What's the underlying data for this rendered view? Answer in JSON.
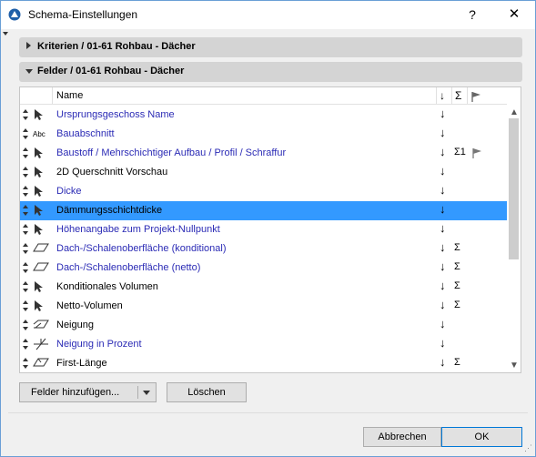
{
  "window": {
    "title": "Schema-Einstellungen",
    "help_label": "?",
    "close_label": "✕"
  },
  "sections": {
    "criteria": {
      "label": "Kriterien / 01-61 Rohbau - Dächer",
      "expanded": false
    },
    "fields": {
      "label": "Felder / 01-61 Rohbau - Dächer",
      "expanded": true
    }
  },
  "list": {
    "header": {
      "name": "Name",
      "sort_icon": "↓",
      "sum_icon": "Σ",
      "flag_icon": "flag-icon"
    },
    "rows": [
      {
        "label": "Ursprungsgeschoss Name",
        "type_icon": "pointer-icon",
        "color": "blue",
        "sort": "↓",
        "sum": "",
        "flag": false,
        "selected": false
      },
      {
        "label": "Bauabschnitt",
        "type_icon": "abc-icon",
        "type_text": "Abc",
        "color": "blue",
        "sort": "↓",
        "sum": "",
        "flag": false,
        "selected": false
      },
      {
        "label": "Baustoff / Mehrschichtiger Aufbau / Profil / Schraffur",
        "type_icon": "pointer-icon",
        "color": "blue",
        "sort": "↓",
        "sum": "Σ1",
        "flag": true,
        "selected": false
      },
      {
        "label": "2D Querschnitt Vorschau",
        "type_icon": "pointer-icon",
        "color": "black",
        "sort": "↓",
        "sum": "",
        "flag": false,
        "selected": false
      },
      {
        "label": "Dicke",
        "type_icon": "pointer-icon",
        "color": "blue",
        "sort": "↓",
        "sum": "",
        "flag": false,
        "selected": false
      },
      {
        "label": "Dämmungsschichtdicke",
        "type_icon": "pointer-icon",
        "color": "blue",
        "sort": "↓",
        "sum": "",
        "flag": false,
        "selected": true
      },
      {
        "label": "Höhenangabe zum Projekt-Nullpunkt",
        "type_icon": "pointer-icon",
        "color": "blue",
        "sort": "↓",
        "sum": "",
        "flag": false,
        "selected": false
      },
      {
        "label": "Dach-/Schalenoberfläche (konditional)",
        "type_icon": "surface-icon",
        "color": "blue",
        "sort": "↓",
        "sum": "Σ",
        "flag": false,
        "selected": false
      },
      {
        "label": "Dach-/Schalenoberfläche (netto)",
        "type_icon": "surface-icon",
        "color": "blue",
        "sort": "↓",
        "sum": "Σ",
        "flag": false,
        "selected": false
      },
      {
        "label": "Konditionales Volumen",
        "type_icon": "pointer-icon",
        "color": "black",
        "sort": "↓",
        "sum": "Σ",
        "flag": false,
        "selected": false
      },
      {
        "label": "Netto-Volumen",
        "type_icon": "pointer-icon",
        "color": "black",
        "sort": "↓",
        "sum": "Σ",
        "flag": false,
        "selected": false
      },
      {
        "label": "Neigung",
        "type_icon": "slope-icon",
        "color": "black",
        "sort": "↓",
        "sum": "",
        "flag": false,
        "selected": false
      },
      {
        "label": "Neigung in Prozent",
        "type_icon": "slope-percent-icon",
        "color": "blue",
        "sort": "↓",
        "sum": "",
        "flag": false,
        "selected": false
      },
      {
        "label": "First-Länge",
        "type_icon": "ridge-icon",
        "color": "black",
        "sort": "↓",
        "sum": "Σ",
        "flag": false,
        "selected": false
      }
    ]
  },
  "buttons": {
    "add_fields": "Felder hinzufügen...",
    "delete": "Löschen",
    "cancel": "Abbrechen",
    "ok": "OK"
  },
  "colors": {
    "selection": "#3399ff",
    "blue_text": "#2b2bb5",
    "section_bg": "#d4d4d4"
  }
}
